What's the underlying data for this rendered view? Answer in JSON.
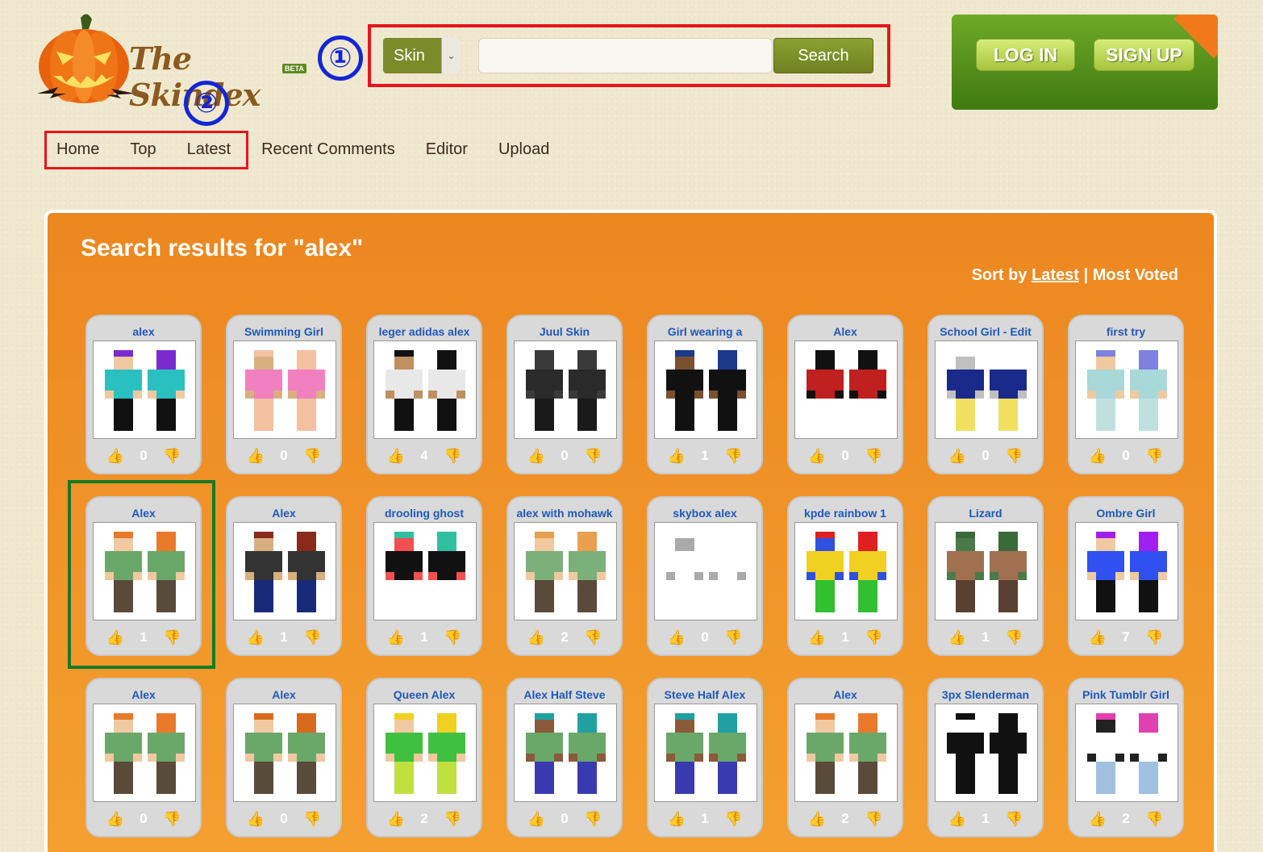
{
  "header": {
    "logo_text": "The Skindex",
    "beta_label": "BETA",
    "marker_1": "①",
    "marker_2": "②",
    "search": {
      "type_selected": "Skin",
      "placeholder": "",
      "button_label": "Search"
    },
    "login_label": "LOG IN",
    "signup_label": "SIGN UP"
  },
  "nav": {
    "items": [
      "Home",
      "Top",
      "Latest",
      "Recent Comments",
      "Editor",
      "Upload"
    ]
  },
  "results": {
    "title": "Search results for \"alex\"",
    "sort_prefix": "Sort by",
    "sort_latest": "Latest",
    "sort_separator": "|",
    "sort_most_voted": "Most Voted",
    "skins": [
      {
        "name": "alex",
        "votes": "0",
        "palette": [
          "#7a2bd0",
          "#2bc0c0",
          "#111111",
          "#f0c9a0"
        ]
      },
      {
        "name": "Swimming Girl",
        "votes": "0",
        "palette": [
          "#f3c1a0",
          "#f080c0",
          "#f3c1a0",
          "#d8b080"
        ]
      },
      {
        "name": "leger adidas alex",
        "votes": "4",
        "palette": [
          "#111111",
          "#e8e8e8",
          "#111111",
          "#c09060"
        ]
      },
      {
        "name": "Juul Skin",
        "votes": "0",
        "palette": [
          "#3a3a3a",
          "#2a2a2a",
          "#1a1a1a",
          "#3a3a3a"
        ]
      },
      {
        "name": "Girl wearing a",
        "votes": "1",
        "palette": [
          "#1a3a8a",
          "#111111",
          "#111111",
          "#7a5030"
        ]
      },
      {
        "name": "Alex",
        "votes": "0",
        "palette": [
          "#111111",
          "#c02020",
          "#ffffff",
          "#111111"
        ]
      },
      {
        "name": "School Girl - Edit",
        "votes": "0",
        "palette": [
          "#ffffff",
          "#1a2a8a",
          "#f0e060",
          "#c0c0c0"
        ]
      },
      {
        "name": "first try",
        "votes": "0",
        "palette": [
          "#8080e0",
          "#a8d8d8",
          "#c0e0e0",
          "#f0c9a0"
        ]
      },
      {
        "name": "Alex",
        "votes": "1",
        "palette": [
          "#e87a2a",
          "#6aa86a",
          "#5a4a3a",
          "#f0c9a0"
        ]
      },
      {
        "name": "Alex",
        "votes": "1",
        "palette": [
          "#8a2a1a",
          "#333333",
          "#1a2a7a",
          "#d8b080"
        ]
      },
      {
        "name": "drooling ghost",
        "votes": "1",
        "palette": [
          "#30c0a0",
          "#111111",
          "#ffffff",
          "#f05050"
        ]
      },
      {
        "name": "alex with mohawk",
        "votes": "2",
        "palette": [
          "#e8a050",
          "#7ab07a",
          "#5a4a3a",
          "#f0c9a0"
        ]
      },
      {
        "name": "skybox alex",
        "votes": "0",
        "palette": [
          "#ffffff",
          "#ffffff",
          "#ffffff",
          "#aaaaaa"
        ]
      },
      {
        "name": "kpde rainbow 1",
        "votes": "1",
        "palette": [
          "#e02020",
          "#f0d020",
          "#30c030",
          "#3050e0"
        ]
      },
      {
        "name": "Lizard",
        "votes": "1",
        "palette": [
          "#3a6a3a",
          "#a07050",
          "#5a4030",
          "#4a7a4a"
        ]
      },
      {
        "name": "Ombre Girl",
        "votes": "7",
        "palette": [
          "#a020f0",
          "#3050f0",
          "#111111",
          "#f0c9a0"
        ]
      },
      {
        "name": "Alex",
        "votes": "0",
        "palette": [
          "#e87a2a",
          "#6aa86a",
          "#5a4a3a",
          "#f0c9a0"
        ]
      },
      {
        "name": "Alex",
        "votes": "0",
        "palette": [
          "#d86a20",
          "#6aa86a",
          "#5a4a3a",
          "#f0c9a0"
        ]
      },
      {
        "name": "Queen Alex",
        "votes": "2",
        "palette": [
          "#f0d020",
          "#40c040",
          "#c0e040",
          "#f0c9a0"
        ]
      },
      {
        "name": "Alex Half Steve",
        "votes": "0",
        "palette": [
          "#20a0a0",
          "#6aa86a",
          "#3a3ab0",
          "#8a5a3a"
        ]
      },
      {
        "name": "Steve Half Alex",
        "votes": "1",
        "palette": [
          "#20a0a0",
          "#6aa86a",
          "#3a3ab0",
          "#8a5a3a"
        ]
      },
      {
        "name": "Alex",
        "votes": "2",
        "palette": [
          "#e87a2a",
          "#6aa86a",
          "#5a4a3a",
          "#f0c9a0"
        ]
      },
      {
        "name": "3px Slenderman",
        "votes": "1",
        "palette": [
          "#111111",
          "#111111",
          "#111111",
          "#ffffff"
        ]
      },
      {
        "name": "Pink Tumblr Girl",
        "votes": "2",
        "palette": [
          "#e040b0",
          "#ffffff",
          "#a0c0e0",
          "#222222"
        ]
      }
    ]
  }
}
